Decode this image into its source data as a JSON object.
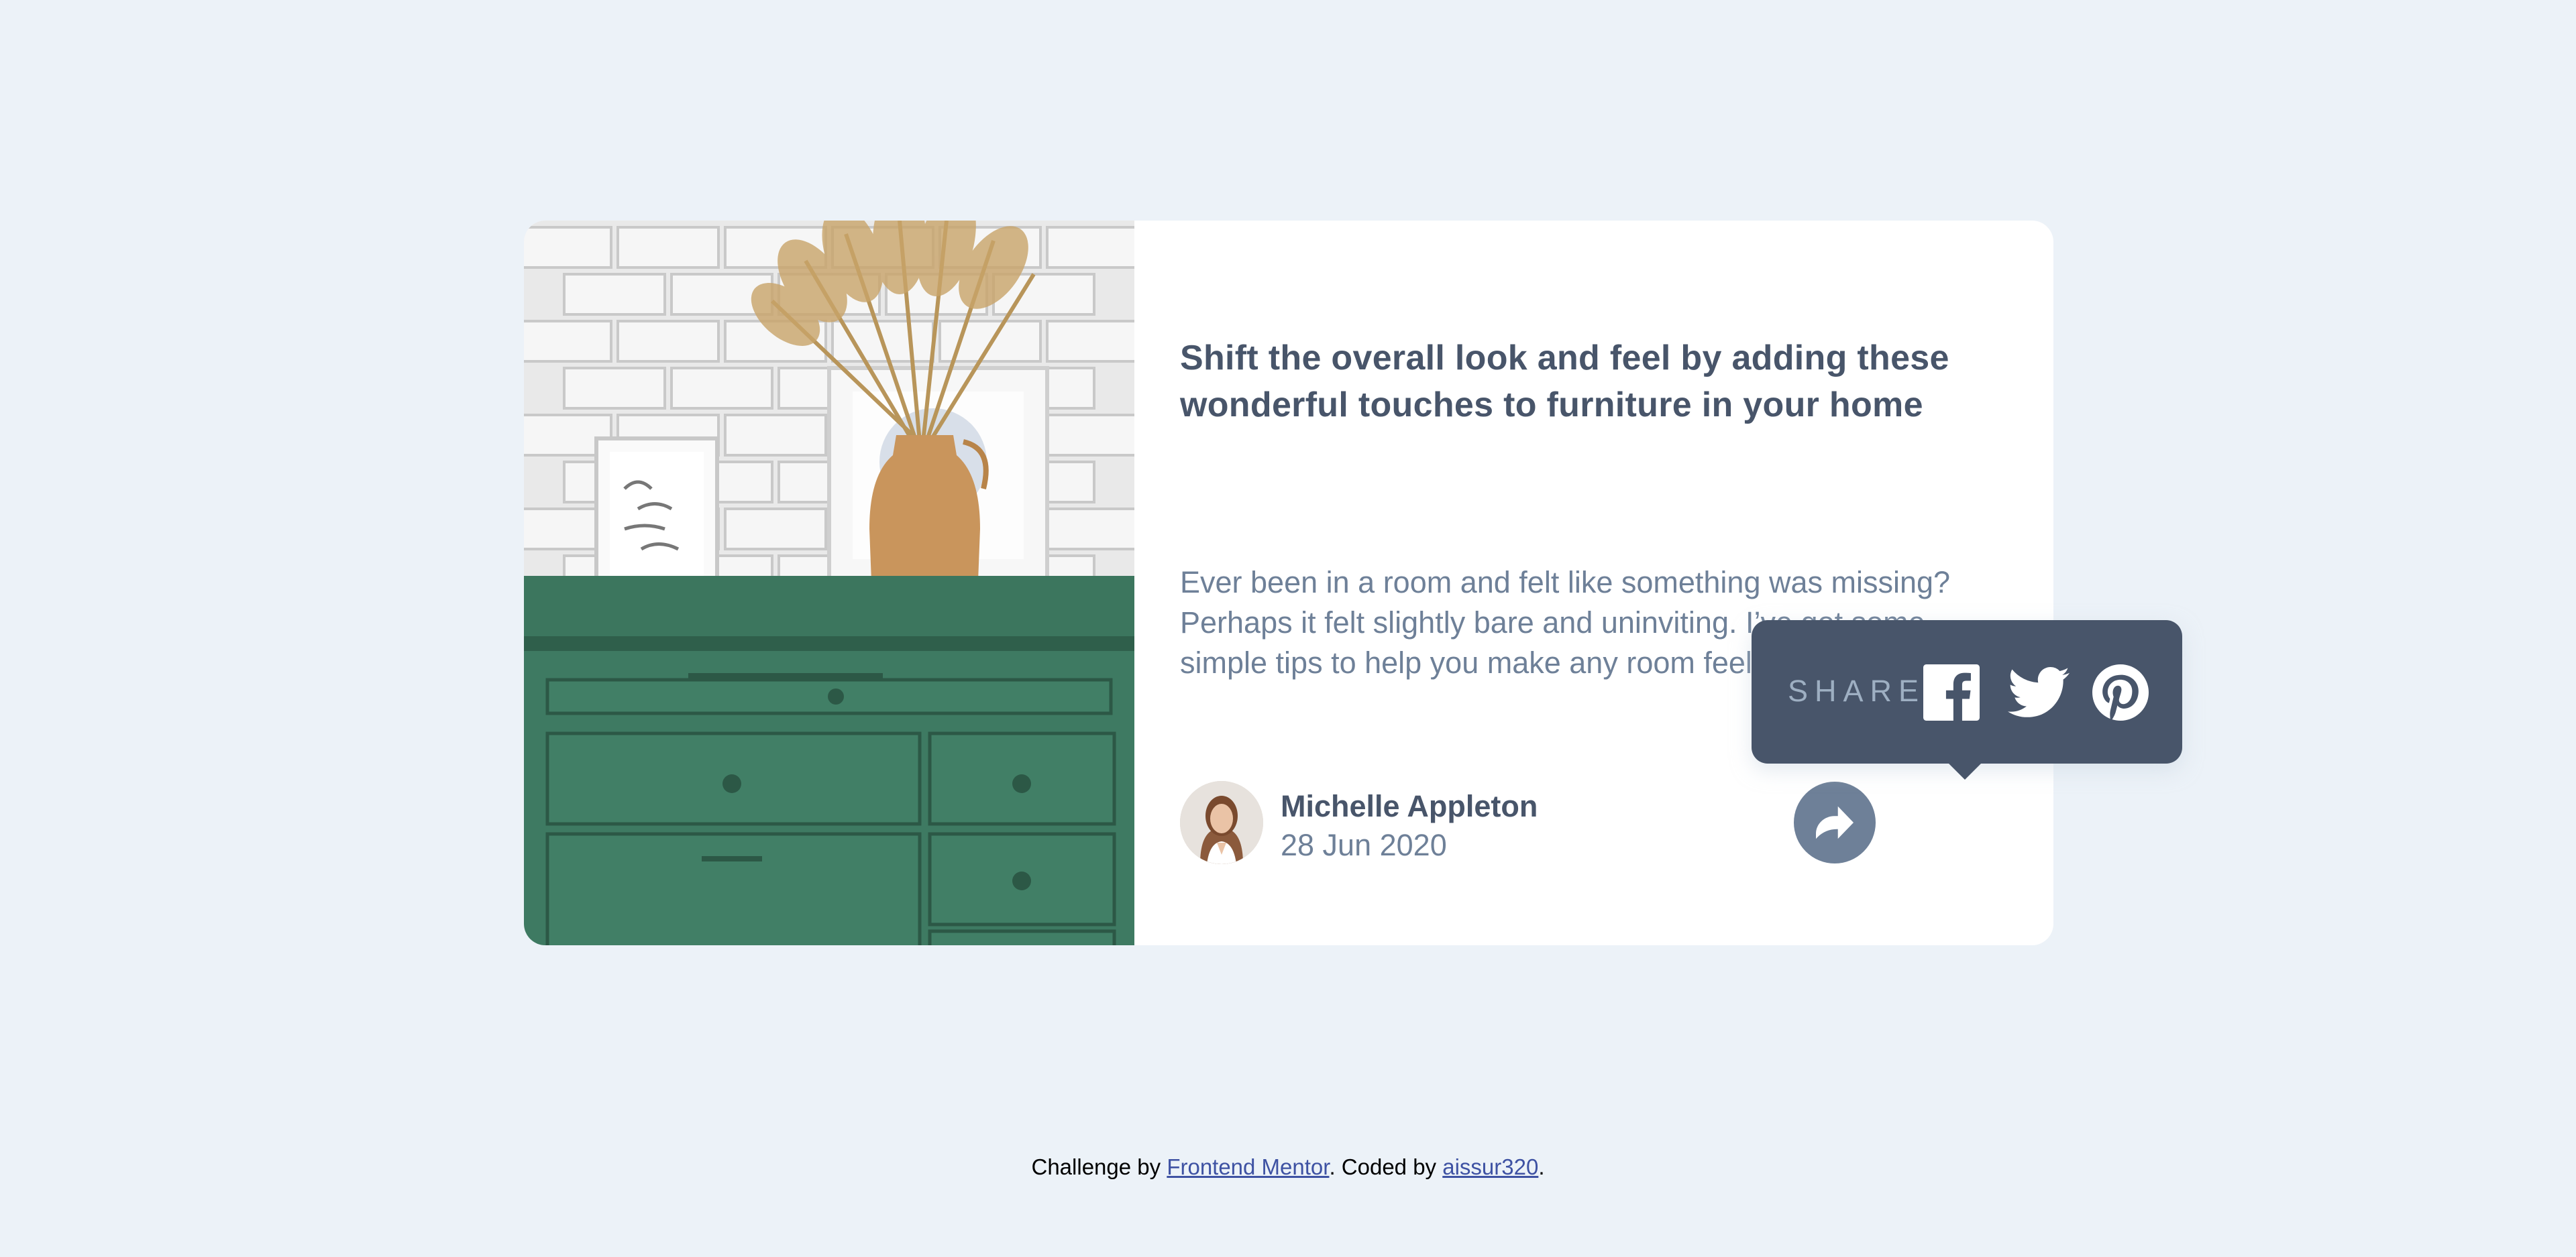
{
  "article": {
    "headline": "Shift the overall look and feel by adding these wonderful touches to furniture in your home",
    "description": "Ever been in a room and felt like something was missing? Perhaps it felt slightly bare and uninviting. I’ve got some simple tips to help you make any room feel complete."
  },
  "author": {
    "name": "Michelle Appleton",
    "date": "28 Jun 2020"
  },
  "share": {
    "label": "SHARE",
    "icons": [
      "facebook-icon",
      "twitter-icon",
      "pinterest-icon"
    ]
  },
  "footer": {
    "prefix": "Challenge by ",
    "link1": "Frontend Mentor",
    "middle": ". Coded by ",
    "link2": "aissur320",
    "suffix": "."
  },
  "colors": {
    "background": "#ecf2f8",
    "card": "#ffffff",
    "heading": "#48556a",
    "body": "#6e8098",
    "tooltip": "#48556a",
    "share_button": "#6e8098",
    "link": "#3e52a3"
  }
}
